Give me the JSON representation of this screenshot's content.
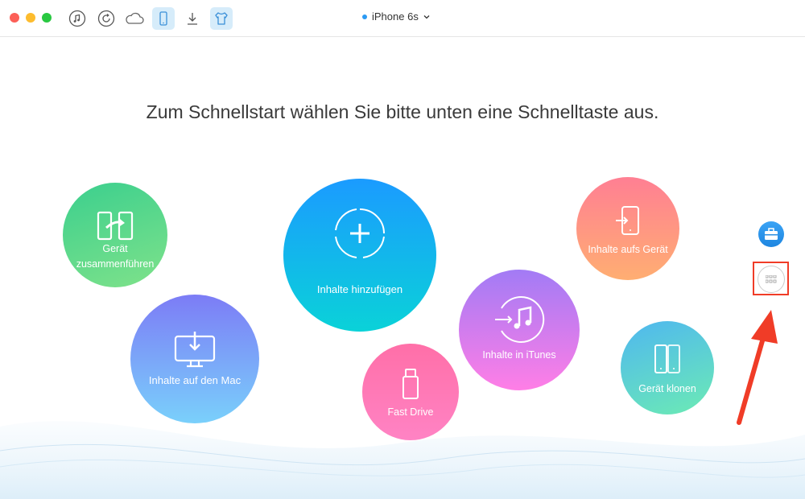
{
  "window": {
    "device_name": "iPhone 6s",
    "device_dropdown": "chevron-down",
    "status_dot_color": "#2b9af3"
  },
  "toolbar": {
    "icons": [
      "music-icon",
      "restore-icon",
      "cloud-icon",
      "phone-icon",
      "download-icon",
      "tshirt-icon"
    ],
    "active": [
      "phone-icon",
      "tshirt-icon"
    ]
  },
  "headline": "Zum Schnellstart wählen Sie bitte unten eine Schnelltaste aus.",
  "bubbles": {
    "merge": {
      "line1": "Gerät",
      "line2": "zusammenführen",
      "colors": [
        "#3bcf8e",
        "#7fe28a"
      ]
    },
    "add": {
      "label": "Inhalte hinzufügen",
      "colors": [
        "#1b9bff",
        "#0ad2d8"
      ]
    },
    "to_device": {
      "label": "Inhalte aufs Gerät",
      "colors": [
        "#ff7f93",
        "#ffae72"
      ]
    },
    "to_mac": {
      "label": "Inhalte auf den Mac",
      "colors": [
        "#7c7cf6",
        "#7ad0fb"
      ]
    },
    "fast_drive": {
      "label": "Fast Drive",
      "colors": [
        "#ff6fa8",
        "#ff83c4"
      ]
    },
    "itunes": {
      "label": "Inhalte in iTunes",
      "colors": [
        "#a27bf5",
        "#ff7ee6"
      ]
    },
    "clone": {
      "label": "Gerät klonen",
      "colors": [
        "#4fb7f0",
        "#6cebb4"
      ]
    }
  },
  "side_buttons": [
    "toolbox-icon",
    "grid-icon"
  ],
  "annotation": {
    "color": "#f03c27"
  }
}
